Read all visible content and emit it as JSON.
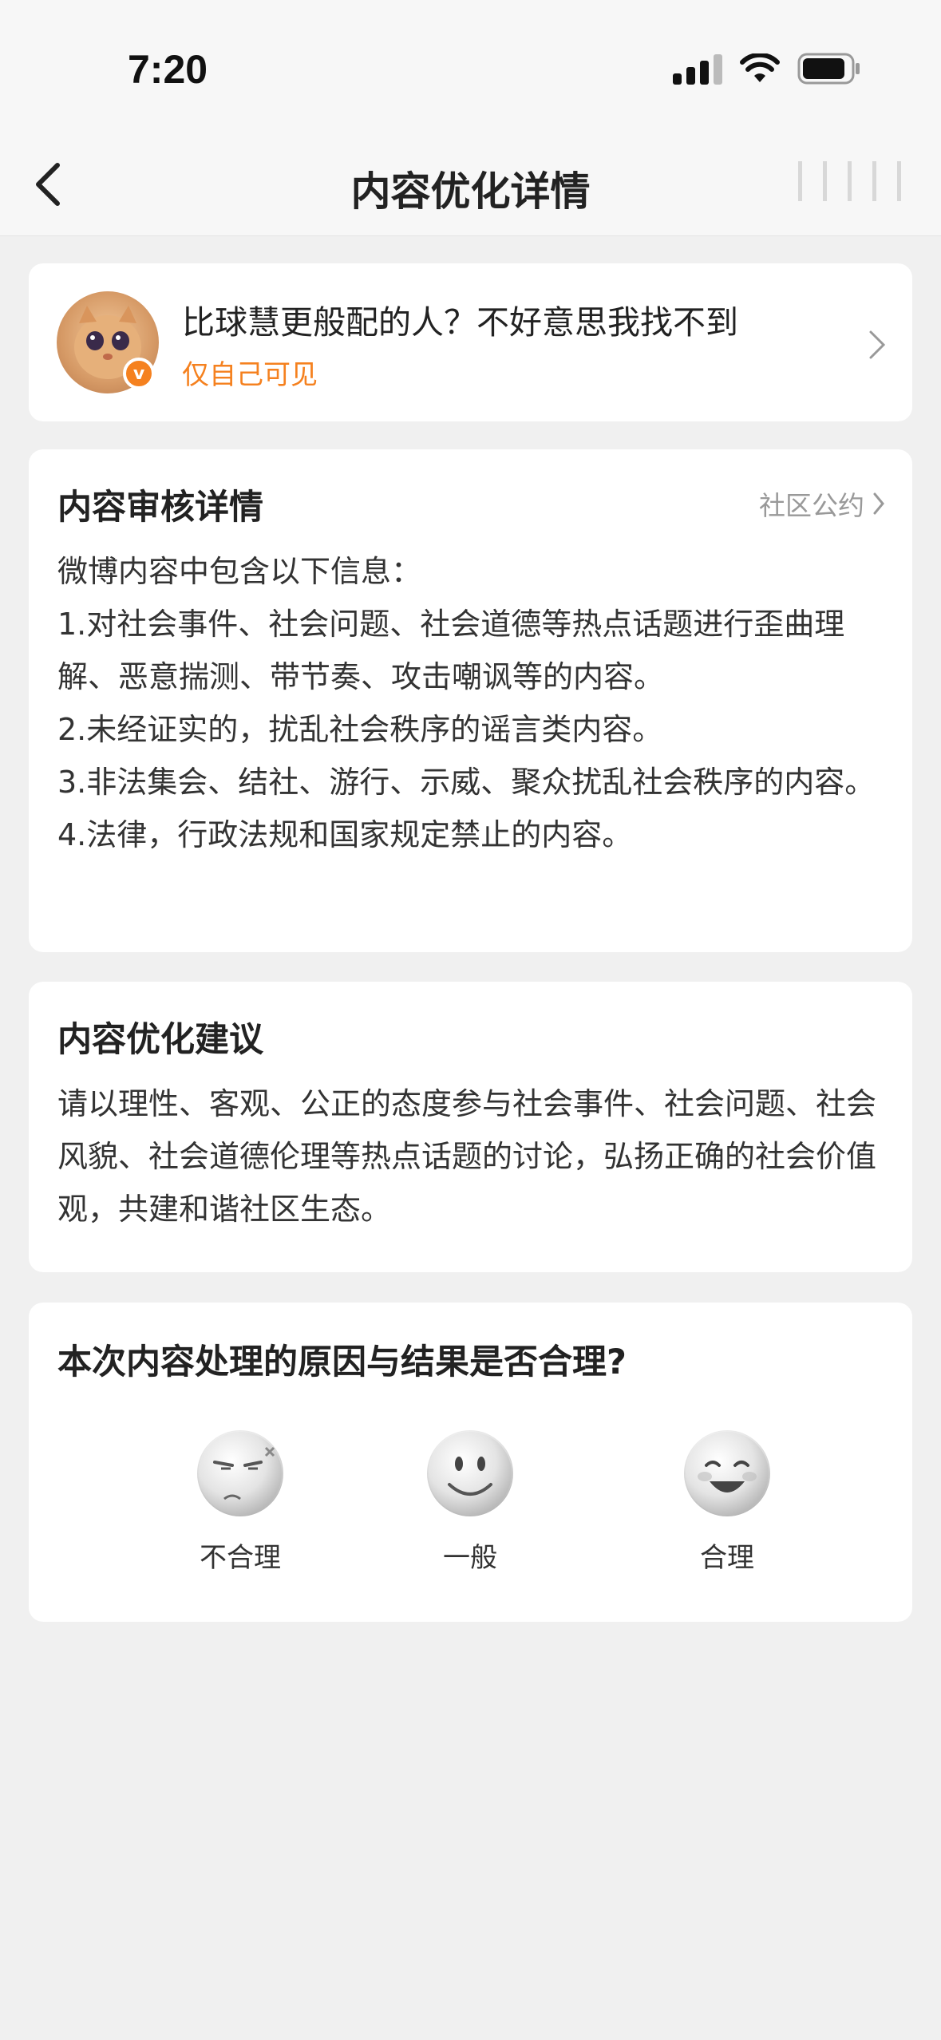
{
  "status_bar": {
    "time": "7:20"
  },
  "nav": {
    "title": "内容优化详情"
  },
  "post": {
    "text": "比球慧更般配的人？不好意思我找不到",
    "visibility": "仅自己可见"
  },
  "review": {
    "title": "内容审核详情",
    "rules_link": "社区公约",
    "lines": [
      "微博内容中包含以下信息：",
      "1.对社会事件、社会问题、社会道德等热点话题进行歪曲理解、恶意揣测、带节奏、攻击嘲讽等的内容。",
      "2.未经证实的，扰乱社会秩序的谣言类内容。",
      "3.非法集会、结社、游行、示威、聚众扰乱社会秩序的内容。",
      "4.法律，行政法规和国家规定禁止的内容。"
    ]
  },
  "suggestion": {
    "title": "内容优化建议",
    "text": "请以理性、客观、公正的态度参与社会事件、社会问题、社会风貌、社会道德伦理等热点话题的讨论，弘扬正确的社会价值观，共建和谐社区生态。"
  },
  "feedback": {
    "question": "本次内容处理的原因与结果是否合理?",
    "options": [
      {
        "label": "不合理",
        "icon": "angry-face-icon"
      },
      {
        "label": "一般",
        "icon": "neutral-face-icon"
      },
      {
        "label": "合理",
        "icon": "happy-face-icon"
      }
    ]
  },
  "colors": {
    "accent": "#f5811f",
    "background": "#f0f0f0",
    "card": "#ffffff"
  }
}
